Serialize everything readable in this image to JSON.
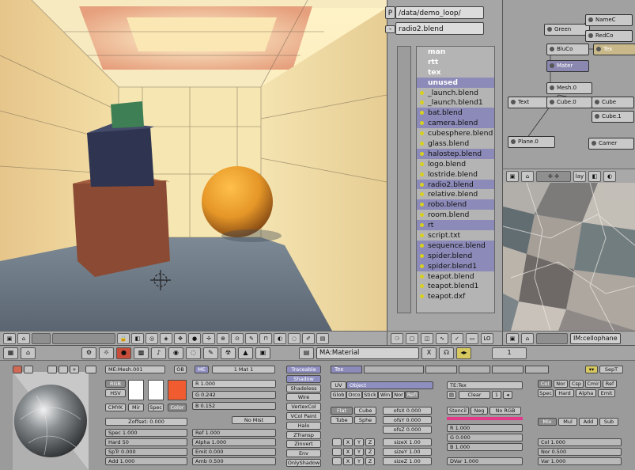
{
  "file_browser": {
    "p_button": "P",
    "minus_button": "-",
    "path": "/data/demo_loop/",
    "filename": "radio2.blend",
    "items": [
      {
        "name": "man",
        "kind": "dir",
        "selected": false
      },
      {
        "name": "rtt",
        "kind": "dir",
        "selected": false
      },
      {
        "name": "tex",
        "kind": "dir",
        "selected": false
      },
      {
        "name": "unused",
        "kind": "dir",
        "selected": true
      },
      {
        "name": "_launch.blend",
        "kind": "file",
        "selected": false
      },
      {
        "name": "_launch.blend1",
        "kind": "file",
        "selected": false
      },
      {
        "name": "bat.blend",
        "kind": "file",
        "selected": true
      },
      {
        "name": "camera.blend",
        "kind": "file",
        "selected": true
      },
      {
        "name": "cubesphere.blend",
        "kind": "file",
        "selected": false
      },
      {
        "name": "glass.blend",
        "kind": "file",
        "selected": false
      },
      {
        "name": "halostep.blend",
        "kind": "file",
        "selected": true
      },
      {
        "name": "logo.blend",
        "kind": "file",
        "selected": false
      },
      {
        "name": "lostride.blend",
        "kind": "file",
        "selected": false
      },
      {
        "name": "radio2.blend",
        "kind": "file",
        "selected": true
      },
      {
        "name": "relative.blend",
        "kind": "file",
        "selected": false
      },
      {
        "name": "robo.blend",
        "kind": "file",
        "selected": true
      },
      {
        "name": "room.blend",
        "kind": "file",
        "selected": false
      },
      {
        "name": "rt",
        "kind": "file",
        "selected": true
      },
      {
        "name": "script.txt",
        "kind": "file",
        "selected": false
      },
      {
        "name": "sequence.blend",
        "kind": "file",
        "selected": true
      },
      {
        "name": "spider.blend",
        "kind": "file",
        "selected": true
      },
      {
        "name": "spider.blend1",
        "kind": "file",
        "selected": true
      },
      {
        "name": "teapot.blend",
        "kind": "file",
        "selected": false
      },
      {
        "name": "teapot.blend1",
        "kind": "file",
        "selected": false
      },
      {
        "name": "teapot.dxf",
        "kind": "file",
        "selected": false
      }
    ]
  },
  "node_editor": {
    "nodes": [
      "Green",
      "NameC",
      "RedCo",
      "BluCo",
      "Tex",
      "Mater",
      "Mesh.0",
      "Text",
      "Cube.0",
      "Cube",
      "Cube.1",
      "Plane.0",
      "Camer"
    ]
  },
  "image_window": {
    "image_name": "IM:cellophane"
  },
  "viewport_toolbar": {
    "lo_label": "LO"
  },
  "buttons_header": {
    "material_name": "MA:Material",
    "close_label": "X",
    "frame_number": "1"
  },
  "material": {
    "me_field": "ME:Mesh.001",
    "ob_label": "OB",
    "me_label": "ME",
    "user_count": "1 Mat 1",
    "rgb_label": "RGB",
    "hsv_label": "HSV",
    "cmyk_label": "CMYK",
    "mir_label": "Mir",
    "spec_label": "Spec",
    "color_label": "Color",
    "zoffset": "Zoffset: 0.000",
    "spec_value": "Spec 1.000",
    "hard_value": "Hard 50",
    "spl_value": "SpTr 0.000",
    "add_value": "Add 1.000",
    "r_value": "R 1.000",
    "g_value": "G 0.242",
    "b_value": "B 0.152",
    "no_mist": "No Mist",
    "ref_value": "Ref 1.000",
    "alpha_value": "Alpha 1.000",
    "emit_value": "Emit 0.000",
    "amb_value": "Amb 0.500",
    "col_fill": 0.8,
    "toggles": [
      "Traceable",
      "Shadow",
      "Shadeless",
      "Wire",
      "VertexCol",
      "VCol Paint",
      "Halo",
      "ZTransp",
      "Zinvert",
      "Env",
      "OnlyShadow"
    ]
  },
  "texture": {
    "tex_tab": "Tex",
    "uv_label": "UV",
    "object_label": "Object",
    "buttons_row": [
      "Glob",
      "Orco",
      "Stick",
      "Win",
      "Nor",
      "Refl"
    ],
    "flat_label": "Flat",
    "cube_label": "Cube",
    "tube_label": "Tube",
    "sphe_label": "Sphe",
    "ofsx": "ofsX 0.000",
    "ofsy": "ofsY 0.000",
    "ofsz": "ofsZ 0.000",
    "sizex": "sizeX 1.00",
    "sizey": "sizeY 1.00",
    "sizez": "sizeZ 1.00",
    "axis_x": "X",
    "axis_y": "Y",
    "axis_z": "Z",
    "te_field": "TE:Tex",
    "clear_label": "Clear",
    "stencil": "Stencil",
    "neg": "Neg",
    "no_rgb": "No RGB",
    "mix_r": "R 1.000",
    "mix_g": "G 0.000",
    "mix_b": "B 1.000",
    "dvar": "DVar 1.000",
    "mode_buttons": [
      "Col",
      "Nor",
      "Csp",
      "Cmir",
      "Ref",
      "Spec",
      "Hard",
      "Alpha",
      "Emit"
    ],
    "blend_buttons": [
      "Mix",
      "Mul",
      "Add",
      "Sub"
    ],
    "col_value": "Col 1.000",
    "nor_value": "Nor 0.500",
    "var_value": "Var 1.000",
    "sepT": "SepT"
  }
}
